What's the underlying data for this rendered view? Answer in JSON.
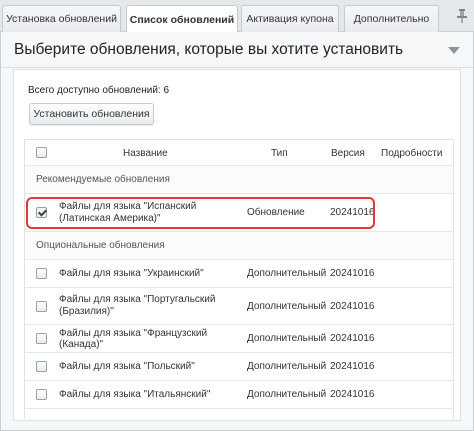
{
  "tabs": [
    {
      "label": "Установка обновлений",
      "active": false
    },
    {
      "label": "Список обновлений",
      "active": true
    },
    {
      "label": "Активация купона",
      "active": false
    },
    {
      "label": "Дополнительно",
      "active": false
    }
  ],
  "panel": {
    "title": "Выберите обновления, которые вы хотите установить",
    "total_label": "Всего доступно обновлений: 6",
    "install_button": "Установить обновления"
  },
  "table": {
    "columns": [
      "Название",
      "Тип",
      "Версия",
      "Подробности"
    ],
    "recommended_label": "Рекомендуемые обновления",
    "optional_label": "Опциональные обновления",
    "recommended": [
      {
        "name": "Файлы для языка \"Испанский (Латинская Америка)\"",
        "type": "Обновление",
        "version": "20241016",
        "checked": true
      }
    ],
    "optional": [
      {
        "name": "Файлы для языка \"Украинский\"",
        "type": "Дополнительный",
        "version": "20241016",
        "checked": false
      },
      {
        "name": "Файлы для языка \"Португальский (Бразилия)\"",
        "type": "Дополнительный",
        "version": "20241016",
        "checked": false
      },
      {
        "name": "Файлы для языка \"Французский (Канада)\"",
        "type": "Дополнительный",
        "version": "20241016",
        "checked": false
      },
      {
        "name": "Файлы для языка \"Польский\"",
        "type": "Дополнительный",
        "version": "20241016",
        "checked": false
      },
      {
        "name": "Файлы для языка \"Итальянский\"",
        "type": "Дополнительный",
        "version": "20241016",
        "checked": false
      }
    ]
  },
  "colors": {
    "highlight": "#e8343a",
    "panel_bg": "#f5f7f8",
    "tab_bar_bg": "#e4e8ea"
  }
}
